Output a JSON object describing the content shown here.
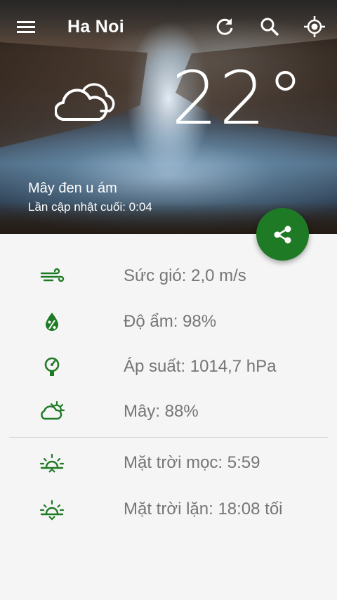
{
  "header": {
    "city": "Ha Noi",
    "menu_icon": "menu-icon",
    "refresh_icon": "refresh-icon",
    "search_icon": "search-icon",
    "location_icon": "my-location-icon"
  },
  "current": {
    "temperature": "22°",
    "condition_icon": "cloud-icon",
    "condition": "Mây đen u ám",
    "last_updated": "Lần cập nhật cuối: 0:04"
  },
  "share": {
    "icon": "share-icon",
    "color": "#1f7a25"
  },
  "details": [
    {
      "icon": "wind-icon",
      "text": "Sức gió: 2,0 m/s"
    },
    {
      "icon": "humidity-icon",
      "text": "Độ ẩm: 98%"
    },
    {
      "icon": "pressure-icon",
      "text": "Áp suất: 1014,7 hPa"
    },
    {
      "icon": "cloudiness-icon",
      "text": "Mây: 88%"
    }
  ],
  "sun": [
    {
      "icon": "sunrise-icon",
      "text": "Mặt trời mọc: 5:59"
    },
    {
      "icon": "sunset-icon",
      "text": "Mặt trời lặn: 18:08 tối"
    }
  ],
  "colors": {
    "accent": "#1f7a25",
    "text_secondary": "#757575",
    "background": "#f5f5f5"
  }
}
